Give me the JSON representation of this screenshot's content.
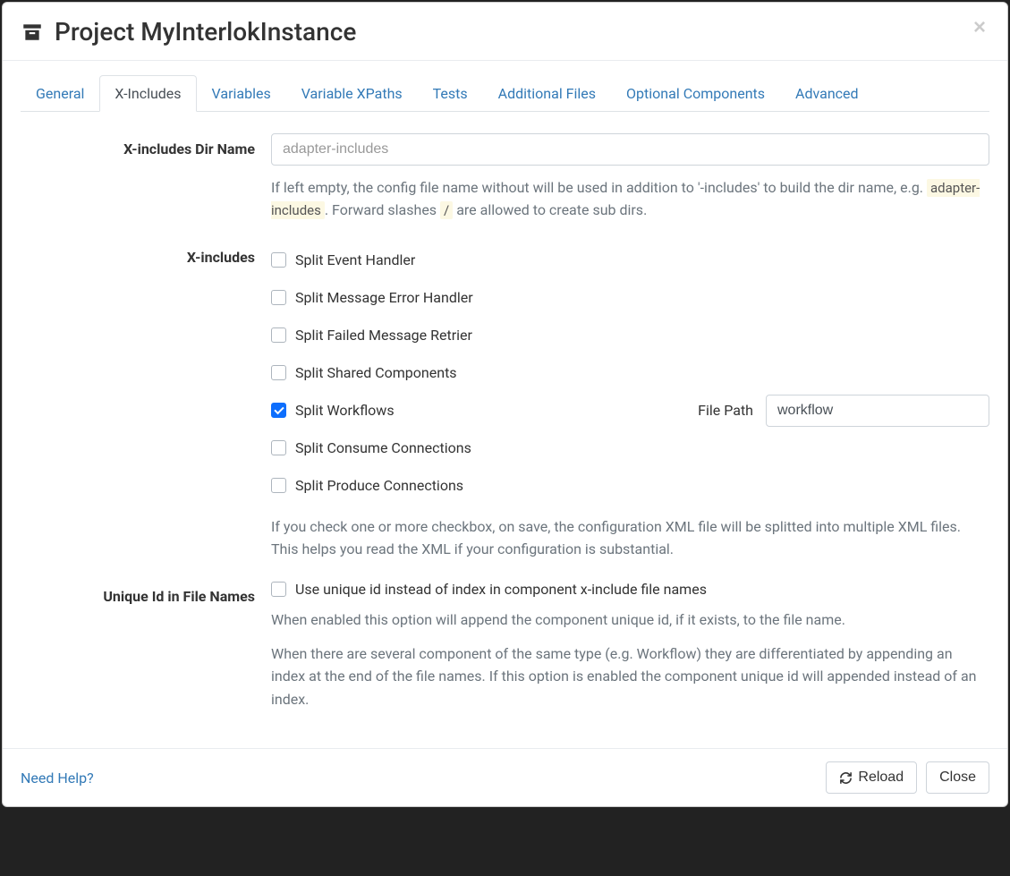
{
  "modal": {
    "title": "Project MyInterlokInstance"
  },
  "tabs": {
    "general": "General",
    "xincludes": "X-Includes",
    "variables": "Variables",
    "variable_xpaths": "Variable XPaths",
    "tests": "Tests",
    "additional_files": "Additional Files",
    "optional_components": "Optional Components",
    "advanced": "Advanced"
  },
  "dir_name": {
    "label": "X-includes Dir Name",
    "placeholder": "adapter-includes",
    "value": "",
    "help_before": "If left empty, the config file name without will be used in addition to '-includes' to build the dir name, e.g. ",
    "help_code1": "adapter-includes",
    "help_mid": ". Forward slashes ",
    "help_code2": "/",
    "help_after": " are allowed to create sub dirs."
  },
  "xinc": {
    "label": "X-includes",
    "items": [
      {
        "label": "Split Event Handler",
        "checked": false
      },
      {
        "label": "Split Message Error Handler",
        "checked": false
      },
      {
        "label": "Split Failed Message Retrier",
        "checked": false
      },
      {
        "label": "Split Shared Components",
        "checked": false
      },
      {
        "label": "Split Workflows",
        "checked": true,
        "file_path_label": "File Path",
        "file_path_value": "workflow"
      },
      {
        "label": "Split Consume Connections",
        "checked": false
      },
      {
        "label": "Split Produce Connections",
        "checked": false
      }
    ],
    "help": "If you check one or more checkbox, on save, the configuration XML file will be splitted into multiple XML files. This helps you read the XML if your configuration is substantial."
  },
  "unique_id": {
    "label": "Unique Id in File Names",
    "checkbox_label": "Use unique id instead of index in component x-include file names",
    "checked": false,
    "help1": "When enabled this option will append the component unique id, if it exists, to the file name.",
    "help2": "When there are several component of the same type (e.g. Workflow) they are differentiated by appending an index at the end of the file names. If this option is enabled the component unique id will appended instead of an index."
  },
  "footer": {
    "help_link": "Need Help?",
    "reload": "Reload",
    "close": "Close"
  }
}
